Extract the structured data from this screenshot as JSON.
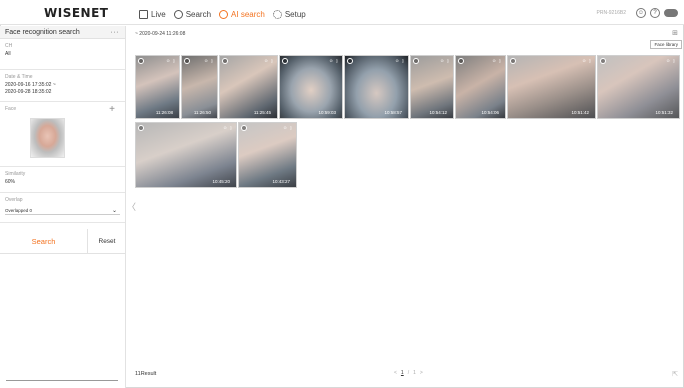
{
  "app": {
    "logo": "WISENET"
  },
  "nav": {
    "items": [
      {
        "label": "Live",
        "icon": "monitor-icon"
      },
      {
        "label": "Search",
        "icon": "search-icon"
      },
      {
        "label": "AI search",
        "icon": "ai-icon",
        "active": true
      },
      {
        "label": "Setup",
        "icon": "gear-icon"
      }
    ],
    "device_id": "PRN-9216B2",
    "accent_color": "#f37321"
  },
  "sidebar": {
    "title": "Face recognition search",
    "more": "···",
    "ch": {
      "label": "CH",
      "value": "All"
    },
    "datetime": {
      "label": "Date & Time",
      "line1": "2020-09-16 17:35:02 ~",
      "line2": "2020-09-28 18:35:02"
    },
    "face": {
      "label": "Face",
      "add": "+"
    },
    "similarity": {
      "label": "Similarity",
      "value": "60%"
    },
    "overlap": {
      "label": "Overlap",
      "value": "Overlapped 0"
    },
    "search_button": "Search",
    "reset_button": "Reset"
  },
  "main": {
    "date_header": "~ 2020-09-24 11:26:08",
    "tooltip": "Face library",
    "thumbnails": [
      {
        "time": "11:26:08"
      },
      {
        "time": "11:26:50"
      },
      {
        "time": "11:25:45"
      },
      {
        "time": "10:59:03"
      },
      {
        "time": "10:58:57"
      },
      {
        "time": "10:54:12"
      },
      {
        "time": "10:54:06"
      },
      {
        "time": "10:51:42"
      },
      {
        "time": "10:51:32"
      },
      {
        "time": "10:45:20"
      },
      {
        "time": "10:43:27"
      }
    ],
    "result_count": "11Result",
    "pager": {
      "prev": "<",
      "current": "1",
      "separator": "/",
      "total": "1",
      "next": ">"
    }
  }
}
